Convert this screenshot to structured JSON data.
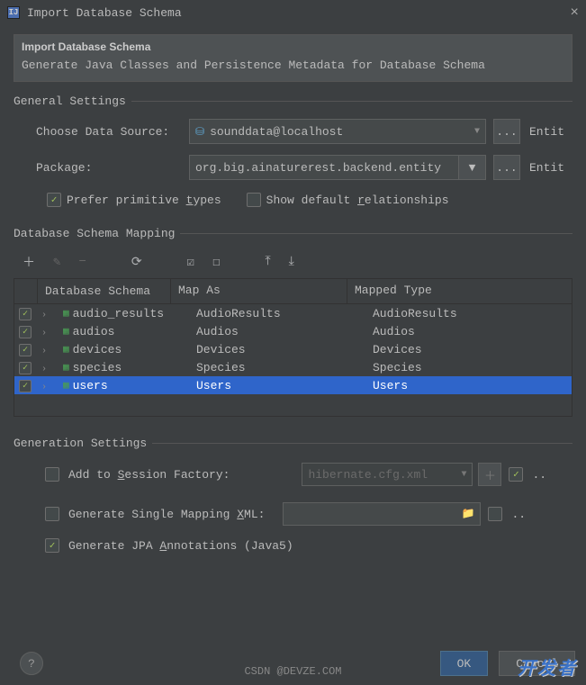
{
  "window": {
    "title": "Import Database Schema"
  },
  "header": {
    "title": "Import Database Schema",
    "subtitle": "Generate Java Classes and Persistence Metadata for Database Schema"
  },
  "sections": {
    "general": "General Settings",
    "mapping": "Database Schema Mapping",
    "generation": "Generation Settings"
  },
  "general": {
    "data_source_label": "Choose Data Source:",
    "data_source_value": "sounddata@localhost",
    "package_label": "Package:",
    "package_value": "org.big.ainaturerest.backend.entity",
    "entity_label_1": "Entit",
    "entity_label_2": "Entit",
    "more_btn": "...",
    "prefer_primitive": "Prefer primitive types",
    "prefer_primitive_underline": "t",
    "show_default_rel": "Show default relationships",
    "show_default_rel_underline": "r",
    "prefer_primitive_checked": true,
    "show_default_rel_checked": false
  },
  "table": {
    "columns": [
      "",
      "Database Schema",
      "Map As",
      "Mapped Type"
    ],
    "rows": [
      {
        "checked": true,
        "name": "audio_results",
        "map_as": "AudioResults",
        "type": "AudioResults",
        "selected": false
      },
      {
        "checked": true,
        "name": "audios",
        "map_as": "Audios",
        "type": "Audios",
        "selected": false
      },
      {
        "checked": true,
        "name": "devices",
        "map_as": "Devices",
        "type": "Devices",
        "selected": false
      },
      {
        "checked": true,
        "name": "species",
        "map_as": "Species",
        "type": "Species",
        "selected": false
      },
      {
        "checked": true,
        "name": "users",
        "map_as": "Users",
        "type": "Users",
        "selected": true
      }
    ]
  },
  "generation": {
    "add_session": "Add to Session Factory:",
    "add_session_underline": "S",
    "add_session_checked": false,
    "session_cfg": "hibernate.cfg.xml",
    "single_xml": "Generate Single Mapping XML:",
    "single_xml_underline": "X",
    "single_xml_checked": false,
    "jpa": "Generate JPA Annotations (Java5)",
    "jpa_underline": "A",
    "jpa_checked": true,
    "right_chk1_checked": true,
    "right_chk2_checked": false,
    "more": "..",
    "more2": ".."
  },
  "footer": {
    "ok": "OK",
    "cancel": "Cancel",
    "help": "?"
  },
  "watermark": {
    "cn": "开发者",
    "csdn": "CSDN @DEVZE.COM"
  }
}
